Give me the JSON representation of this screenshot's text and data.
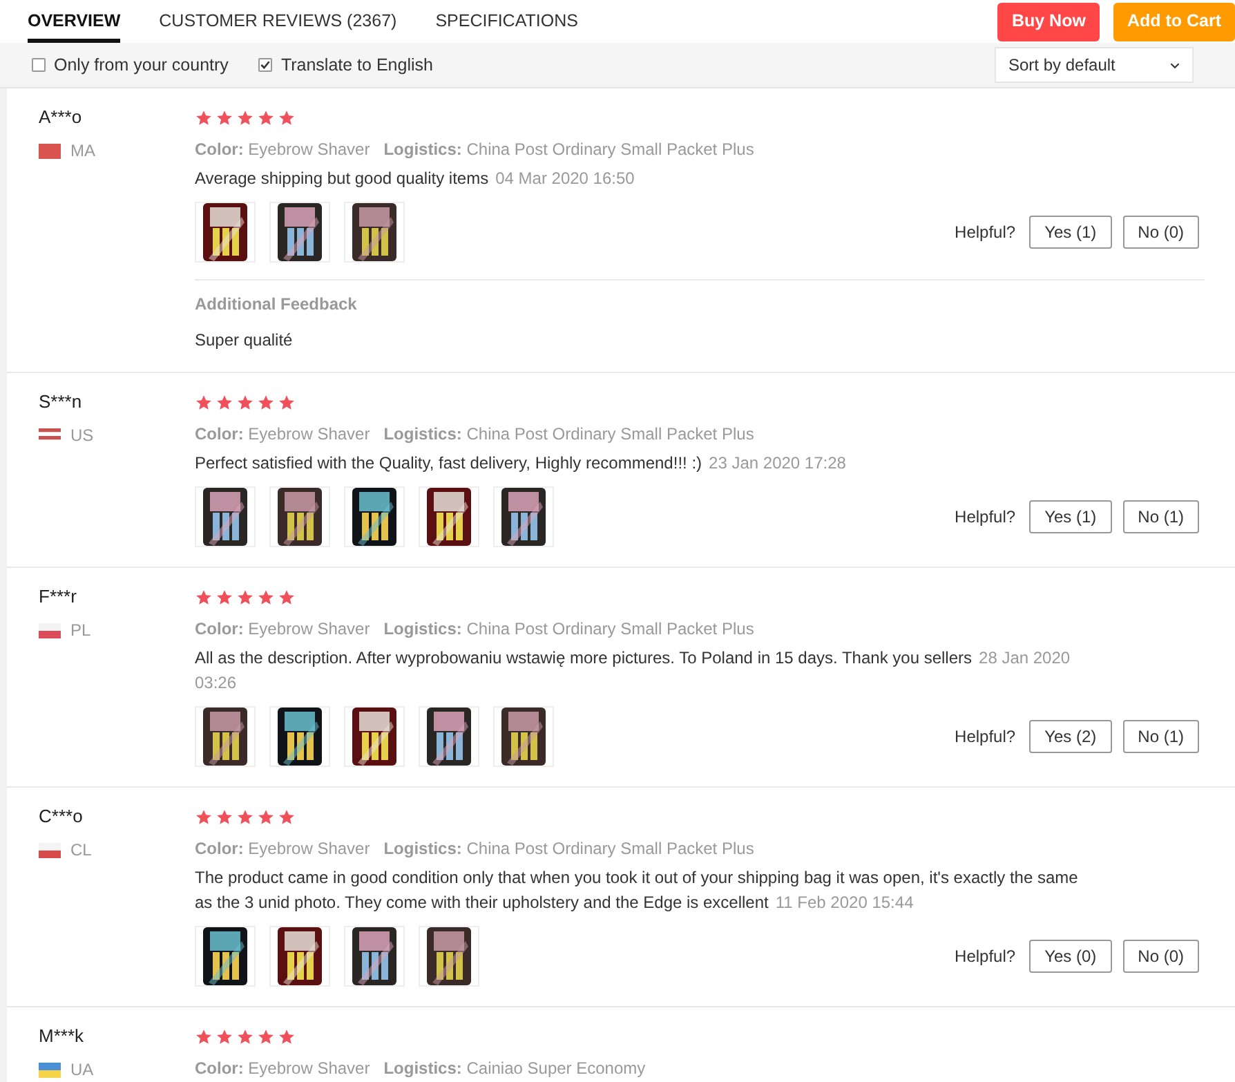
{
  "tabs": [
    {
      "label": "OVERVIEW",
      "selected": true
    },
    {
      "label": "CUSTOMER REVIEWS (2367)",
      "selected": false
    },
    {
      "label": "SPECIFICATIONS",
      "selected": false
    }
  ],
  "actions": {
    "buy_now": "Buy Now",
    "add_to_cart": "Add to Cart"
  },
  "filters": [
    {
      "label": "Only from your country",
      "checked": false
    },
    {
      "label": "Translate to English",
      "checked": true
    }
  ],
  "sort": {
    "value": "Sort by default"
  },
  "reviews": [
    {
      "name": "A***o",
      "country": "MA",
      "flag": [
        {
          "color": "#d9534f"
        }
      ],
      "stars": 5,
      "color_label": "Color:",
      "variant": "Eyebrow Shaver",
      "logistics_label": "Logistics:",
      "logistics": "China Post Ordinary Small Packet Plus",
      "text": "Average shipping but good quality items",
      "date": "04 Mar 2020 16:50",
      "photos": [
        {
          "kind": "picture"
        },
        {
          "kind": "picture"
        },
        {
          "kind": "picture"
        }
      ],
      "helpful": "Helpful?",
      "yes": "Yes (1)",
      "no": "No (0)",
      "additional_title": "Additional Feedback",
      "additional_text": "Super qualité"
    },
    {
      "name": "S***n",
      "country": "US",
      "flag": [
        {
          "color": "#c8504f"
        },
        {
          "color": "#ffffff"
        },
        {
          "color": "#c8504f"
        },
        {
          "color": "#ffffff"
        }
      ],
      "stars": 5,
      "color_label": "Color:",
      "variant": "Eyebrow Shaver",
      "logistics_label": "Logistics:",
      "logistics": "China Post Ordinary Small Packet Plus",
      "text": "Perfect satisfied with the Quality, fast delivery, Highly recommend!!! :)",
      "date": "23 Jan 2020 17:28",
      "photos": [
        {
          "kind": "picture"
        },
        {
          "kind": "picture"
        },
        {
          "kind": "picture"
        },
        {
          "kind": "picture"
        },
        {
          "kind": "picture"
        }
      ],
      "helpful": "Helpful?",
      "yes": "Yes (1)",
      "no": "No (1)"
    },
    {
      "name": "F***r",
      "country": "PL",
      "flag": [
        {
          "color": "#f4f4f4"
        },
        {
          "color": "#dc4c5a"
        }
      ],
      "stars": 5,
      "color_label": "Color:",
      "variant": "Eyebrow Shaver",
      "logistics_label": "Logistics:",
      "logistics": "China Post Ordinary Small Packet Plus",
      "text": "All as the description. After wyprobowaniu wstawię more pictures. To Poland in 15 days. Thank you sellers",
      "date": "28 Jan 2020 03:26",
      "photos": [
        {
          "kind": "picture"
        },
        {
          "kind": "picture"
        },
        {
          "kind": "picture"
        },
        {
          "kind": "picture"
        },
        {
          "kind": "picture"
        }
      ],
      "helpful": "Helpful?",
      "yes": "Yes (2)",
      "no": "No (1)"
    },
    {
      "name": "C***o",
      "country": "CL",
      "flag": [
        {
          "color": "#f4f4f4"
        },
        {
          "color": "#d64a4a"
        }
      ],
      "stars": 5,
      "color_label": "Color:",
      "variant": "Eyebrow Shaver",
      "logistics_label": "Logistics:",
      "logistics": "China Post Ordinary Small Packet Plus",
      "text": "The product came in good condition only that when you took it out of your shipping bag it was open, it's exactly the same as the 3 unid photo. They come with their upholstery and the Edge is excellent",
      "date": "11 Feb 2020 15:44",
      "photos": [
        {
          "kind": "picture"
        },
        {
          "kind": "picture"
        },
        {
          "kind": "picture"
        },
        {
          "kind": "picture"
        }
      ],
      "helpful": "Helpful?",
      "yes": "Yes (0)",
      "no": "No (0)"
    },
    {
      "name": "M***k",
      "country": "UA",
      "flag": [
        {
          "color": "#4a8fd6"
        },
        {
          "color": "#f5d547"
        }
      ],
      "stars": 5,
      "color_label": "Color:",
      "variant": "Eyebrow Shaver",
      "logistics_label": "Logistics:",
      "logistics": "Cainiao Super Economy"
    }
  ]
}
